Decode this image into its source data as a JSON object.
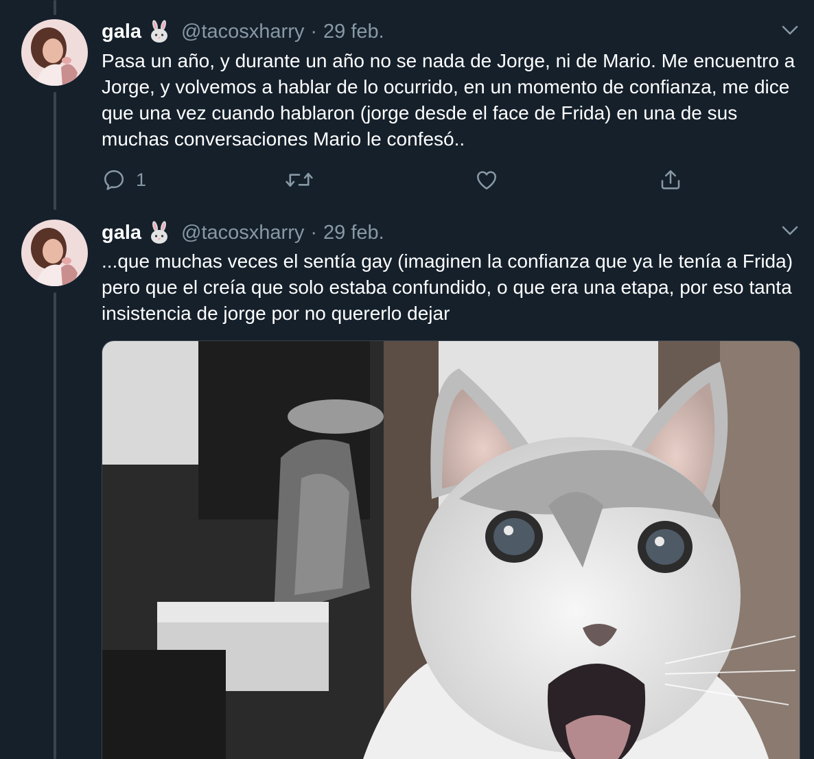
{
  "colors": {
    "background": "#15202b",
    "text_primary": "#ffffff",
    "text_secondary": "#8899a6",
    "thread_line": "#38444d"
  },
  "tweets": [
    {
      "name": "gala",
      "emoji": "rabbit-face-icon",
      "handle": "@tacosxharry",
      "separator": "·",
      "time": "29 feb.",
      "text": "Pasa un año, y durante un año no se nada de Jorge, ni de Mario. Me encuentro a Jorge, y volvemos a hablar de lo ocurrido, en un momento de confianza, me dice que una vez cuando hablaron (jorge desde el face de Frida) en una de sus muchas conversaciones Mario le confesó..",
      "actions": {
        "reply_count": "1",
        "retweet_count": "",
        "like_count": ""
      }
    },
    {
      "name": "gala",
      "emoji": "rabbit-face-icon",
      "handle": "@tacosxharry",
      "separator": "·",
      "time": "29 feb.",
      "text": "...que muchas veces el sentía gay (imaginen la confianza que ya le tenía a Frida) pero que el creía que solo estaba confundido, o que era una etapa, por eso tanta insistencia de jorge por no quererlo dejar",
      "media": "surprised-cat-image"
    }
  ]
}
